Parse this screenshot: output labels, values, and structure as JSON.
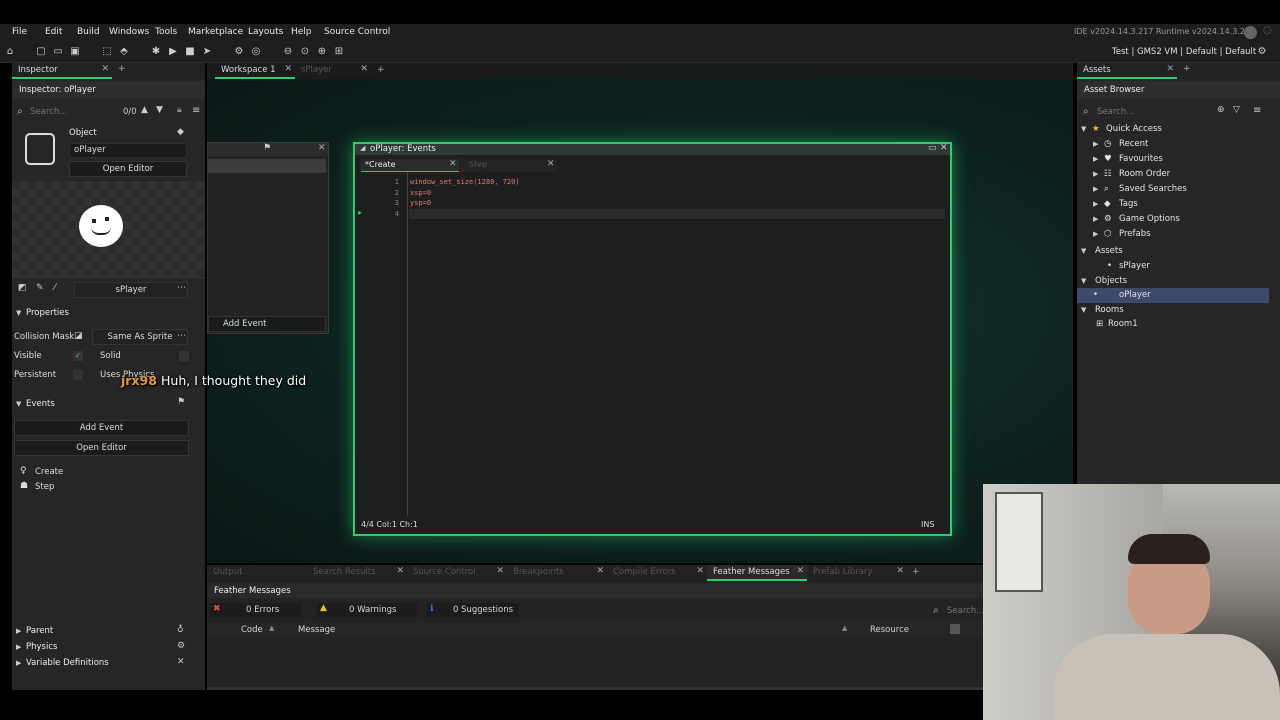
{
  "menubar": {
    "items": [
      "File",
      "Edit",
      "Build",
      "Windows",
      "Tools",
      "Marketplace",
      "Layouts",
      "Help",
      "Source Control"
    ],
    "version": "IDE v2024.14.3.217  Runtime v2024.14.3.260"
  },
  "toolbar": {
    "target": "Test | GMS2 VM | Default | Default"
  },
  "inspector": {
    "tab": "Inspector",
    "title": "Inspector: oPlayer",
    "search_placeholder": "Search...",
    "search_count": "0/0",
    "object_label": "Object",
    "object_name": "oPlayer",
    "open_editor": "Open Editor",
    "sprite_name": "sPlayer",
    "properties_header": "Properties",
    "collision_mask_label": "Collision Mask",
    "collision_mask_value": "Same As Sprite",
    "visible_label": "Visible",
    "solid_label": "Solid",
    "persistent_label": "Persistent",
    "uses_physics_label": "Uses Physics",
    "events_header": "Events",
    "add_event": "Add Event",
    "open_editor2": "Open Editor",
    "events": [
      "Create",
      "Step"
    ],
    "parent_header": "Parent",
    "physics_header": "Physics",
    "variable_definitions_header": "Variable Definitions"
  },
  "workspace": {
    "tabs": [
      "Workspace 1",
      "sPlayer"
    ],
    "object_window_add_event": "Add Event",
    "events_window_title": "oPlayer: Events",
    "event_tabs": [
      "*Create",
      "Step"
    ],
    "code_lines": [
      {
        "num": "1",
        "text": "window_set_size(1280, 720)"
      },
      {
        "num": "2",
        "text": "xsp=0"
      },
      {
        "num": "3",
        "text": "ysp=0"
      },
      {
        "num": "4",
        "text": ""
      }
    ],
    "status_left": "4/4 Col:1 Ch:1",
    "status_right": "INS"
  },
  "assets": {
    "tab": "Assets",
    "title": "Asset Browser",
    "search_placeholder": "Search...",
    "quick_access": "Quick Access",
    "quick_items": [
      "Recent",
      "Favourites",
      "Room Order",
      "Saved Searches",
      "Tags",
      "Game Options",
      "Prefabs"
    ],
    "groups": [
      {
        "name": "Assets",
        "child": "sPlayer"
      },
      {
        "name": "Objects",
        "child": "oPlayer"
      },
      {
        "name": "Rooms",
        "child": "Room1"
      }
    ]
  },
  "bottom": {
    "tabs": [
      "Output",
      "Search Results",
      "Source Control",
      "Breakpoints",
      "Compile Errors",
      "Feather Messages",
      "Prefab Library"
    ],
    "active_tab": "Feather Messages",
    "panel_title": "Feather Messages",
    "errors": "0 Errors",
    "warnings": "0 Warnings",
    "suggestions": "0 Suggestions",
    "search_placeholder": "Search...",
    "col_code": "Code",
    "col_message": "Message",
    "col_resource": "Resource"
  },
  "chat": {
    "user": "jrx98",
    "message": "Huh, I thought they did"
  },
  "colors": {
    "accent": "#2ecc71",
    "selection": "#3d4a6b",
    "chat_user": "#e39a3b"
  }
}
